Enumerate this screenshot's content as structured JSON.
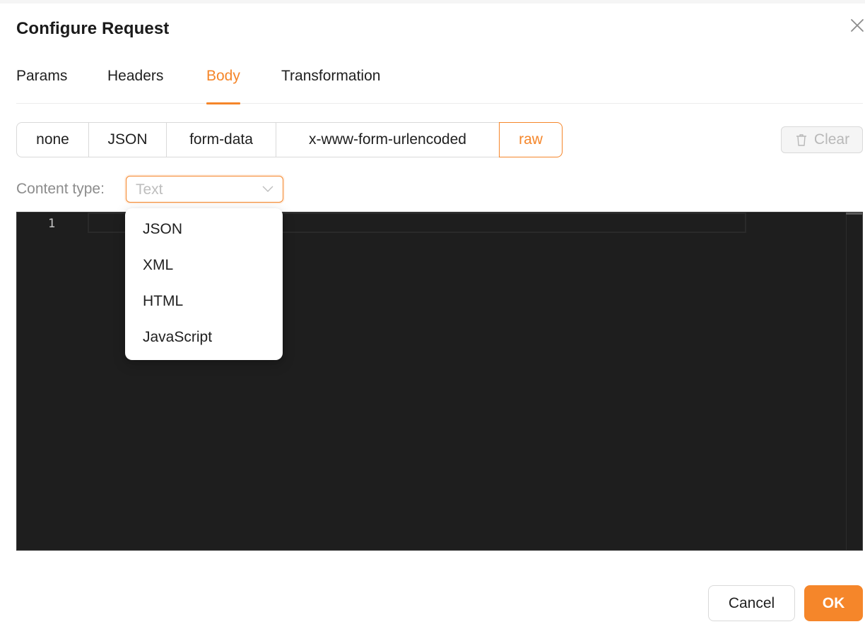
{
  "dialog": {
    "title": "Configure Request"
  },
  "tabs": [
    {
      "label": "Params"
    },
    {
      "label": "Headers"
    },
    {
      "label": "Body",
      "active": true
    },
    {
      "label": "Transformation"
    }
  ],
  "body_types": [
    {
      "label": "none"
    },
    {
      "label": "JSON"
    },
    {
      "label": "form-data"
    },
    {
      "label": "x-www-form-urlencoded"
    },
    {
      "label": "raw",
      "active": true
    }
  ],
  "toolbar": {
    "clear_label": "Clear",
    "clear_icon": "trash-icon"
  },
  "content_type": {
    "label": "Content type:",
    "placeholder": "Text",
    "options": [
      "JSON",
      "XML",
      "HTML",
      "JavaScript"
    ]
  },
  "editor": {
    "line_numbers": [
      "1"
    ]
  },
  "footer": {
    "cancel_label": "Cancel",
    "ok_label": "OK"
  },
  "colors": {
    "accent": "#f5862a",
    "editor_bg": "#1e1e1e"
  }
}
